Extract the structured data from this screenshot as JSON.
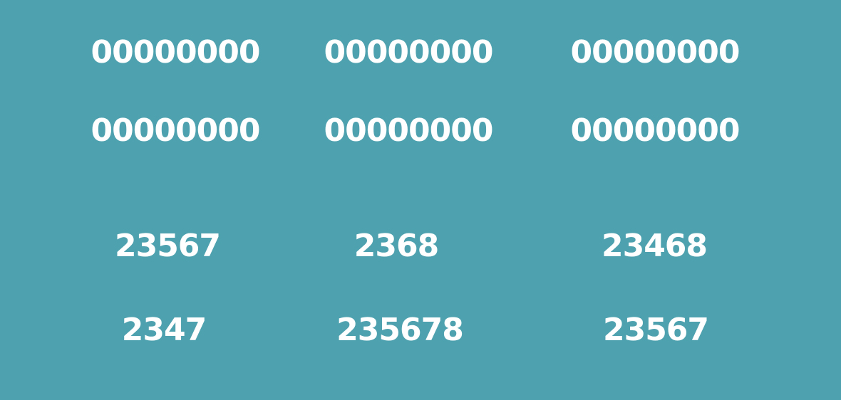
{
  "grid": {
    "row1": [
      "00000000",
      "00000000",
      "00000000"
    ],
    "row2": [
      "00000000",
      "00000000",
      "00000000"
    ],
    "row3": [
      "23567",
      "2368",
      "23468"
    ],
    "row4": [
      "2347",
      "235678",
      "23567"
    ]
  },
  "colors": {
    "background": "#4ea1ae",
    "text": "#ffffff"
  }
}
